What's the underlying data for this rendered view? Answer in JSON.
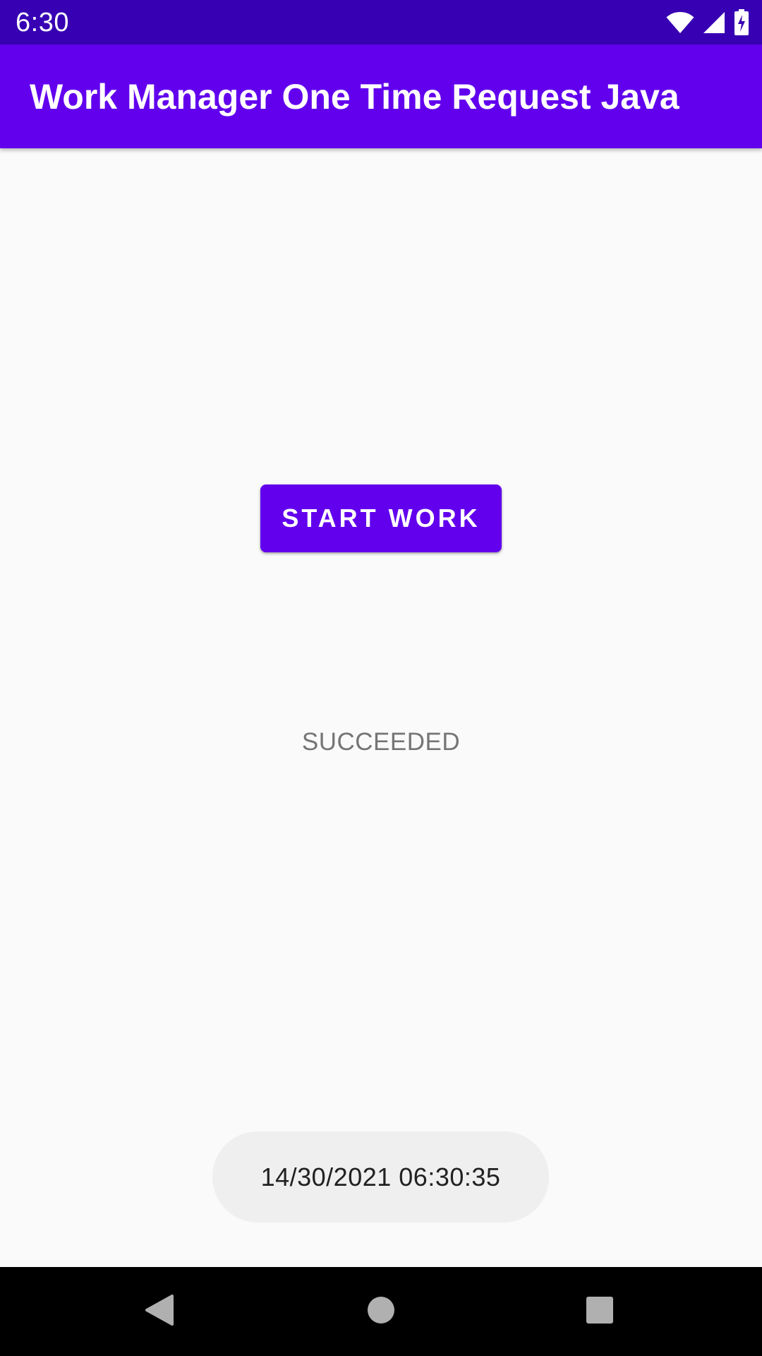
{
  "status_bar": {
    "time": "6:30",
    "icons": [
      "wifi-icon",
      "cell-signal-icon",
      "battery-charging-icon"
    ]
  },
  "app_bar": {
    "title": "Work Manager One Time Request Java"
  },
  "main": {
    "start_button_label": "START WORK",
    "work_status": "SUCCEEDED"
  },
  "toast": {
    "message": "14/30/2021 06:30:35"
  },
  "nav_bar": {
    "buttons": [
      "back-icon",
      "home-icon",
      "recents-icon"
    ]
  },
  "colors": {
    "primary": "#6200EE",
    "primary_dark": "#3700B3",
    "background": "#FAFAFA",
    "status_text": "#757575",
    "toast_background": "#EFEFEF"
  }
}
